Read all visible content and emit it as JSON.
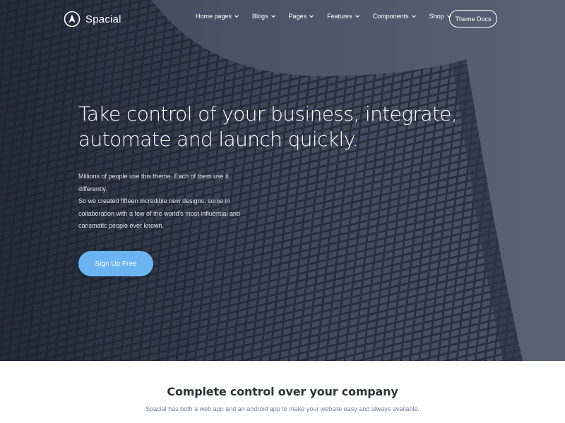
{
  "brand": {
    "name": "Spacial",
    "logo_icon": "compass-arrow-icon"
  },
  "nav": {
    "items": [
      {
        "label": "Home pages"
      },
      {
        "label": "Blogs"
      },
      {
        "label": "Pages"
      },
      {
        "label": "Features"
      },
      {
        "label": "Components"
      },
      {
        "label": "Shop"
      }
    ],
    "docs_button": "Theme Docs"
  },
  "hero": {
    "headline_lines": [
      "Take control of your business, integrate,",
      "automate and launch quickly."
    ],
    "sub_lines": [
      "Millions of people use this theme. Each of them use it",
      "differently.",
      "So we created fifteen incredible new designs, some in",
      "collaboration with a few of the world's most influential and",
      "carismatic people ever known."
    ],
    "cta": "Sign Up Free"
  },
  "section": {
    "title": "Complete control over your company",
    "subtitle": "Spacial has both a web app and an android app to make your website easy and always available."
  },
  "colors": {
    "accent": "#6ab4f1",
    "hero_dark": "#1f2735",
    "text_dark": "#2f3338",
    "text_muted": "#7a8296"
  }
}
